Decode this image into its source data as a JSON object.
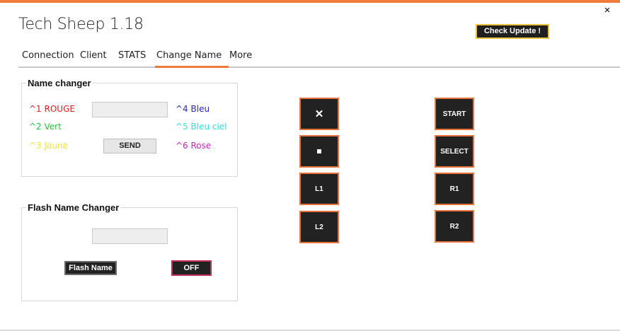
{
  "window": {
    "title": "Tech Sheep 1.18",
    "close_icon": "×",
    "accent": "#f07a3a"
  },
  "header": {
    "check_update_label": "Check Update !"
  },
  "tabs": [
    {
      "label": "Connection"
    },
    {
      "label": "Client"
    },
    {
      "label": "STATS"
    },
    {
      "label": "Change Name",
      "active": true
    },
    {
      "label": "More"
    }
  ],
  "name_changer": {
    "title": "Name changer",
    "colors": [
      {
        "label": "^1 ROUGE",
        "color": "#e02020"
      },
      {
        "label": "^2 Vert",
        "color": "#22c83a"
      },
      {
        "label": "^3 Jaune",
        "color": "#f2e23a"
      },
      {
        "label": "^4 Bleu",
        "color": "#2424c8"
      },
      {
        "label": "^5 Bleu ciel",
        "color": "#2ee0e0"
      },
      {
        "label": "^6 Rose",
        "color": "#d020d0"
      }
    ],
    "name_value": "",
    "send_label": "SEND"
  },
  "flash_name_changer": {
    "title": "Flash Name Changer",
    "name_value": "",
    "flash_label": "Flash Name",
    "toggle_label": "OFF"
  },
  "controller": {
    "left": [
      {
        "label": "✕",
        "icon": "cross-icon"
      },
      {
        "label": "",
        "icon": "square-icon"
      },
      {
        "label": "L1"
      },
      {
        "label": "L2"
      }
    ],
    "right": [
      {
        "label": "START"
      },
      {
        "label": "SELECT"
      },
      {
        "label": "R1"
      },
      {
        "label": "R2"
      }
    ]
  }
}
